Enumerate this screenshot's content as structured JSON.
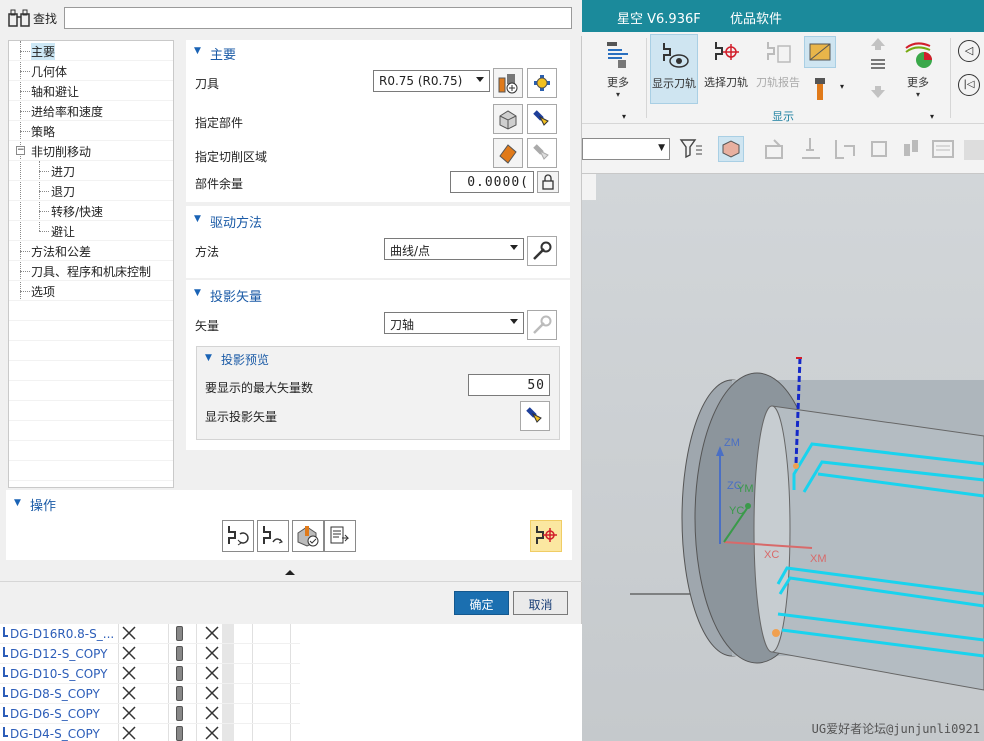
{
  "app": {
    "title": "星空 V6.936F",
    "subtitle": "优品软件"
  },
  "ribbon": {
    "more_label_1": "更多",
    "show_path_label": "显示刀轨",
    "select_path_label": "选择刀轨",
    "path_report_label": "刀轨报告",
    "more_label_2": "更多",
    "group_label": "显示"
  },
  "find": {
    "label": "查找",
    "value": ""
  },
  "tree": {
    "items": [
      {
        "label": "主要"
      },
      {
        "label": "几何体"
      },
      {
        "label": "轴和避让"
      },
      {
        "label": "进给率和速度"
      },
      {
        "label": "策略"
      },
      {
        "label": "非切削移动"
      },
      {
        "label": "进刀"
      },
      {
        "label": "退刀"
      },
      {
        "label": "转移/快速"
      },
      {
        "label": "避让"
      },
      {
        "label": "方法和公差"
      },
      {
        "label": "刀具、程序和机床控制"
      },
      {
        "label": "选项"
      }
    ]
  },
  "main_section": {
    "title": "主要",
    "tool_label": "刀具",
    "tool_value": "R0.75 (R0.75)",
    "part_label": "指定部件",
    "cut_region_label": "指定切削区域",
    "stock_label": "部件余量",
    "stock_value": "0.0000("
  },
  "drive_section": {
    "title": "驱动方法",
    "method_label": "方法",
    "method_value": "曲线/点"
  },
  "projection_section": {
    "title": "投影矢量",
    "vector_label": "矢量",
    "vector_value": "刀轴",
    "preview": {
      "title": "投影预览",
      "max_vectors_label": "要显示的最大矢量数",
      "max_vectors_value": "50",
      "show_vectors_label": "显示投影矢量"
    }
  },
  "operations": {
    "title": "操作"
  },
  "footer": {
    "ok_label": "确定",
    "cancel_label": "取消"
  },
  "viewport": {
    "axis_zm": "ZM",
    "axis_zc": "ZC",
    "axis_ym": "YM",
    "axis_yc": "YC",
    "axis_xc": "XC",
    "axis_xm": "XM",
    "watermark": "UG爱好者论坛@junjunli0921"
  },
  "operation_list": {
    "rows": [
      {
        "name": "DG-D16R0.8-S_..."
      },
      {
        "name": "DG-D12-S_COPY"
      },
      {
        "name": "DG-D10-S_COPY"
      },
      {
        "name": "DG-D8-S_COPY"
      },
      {
        "name": "DG-D6-S_COPY"
      },
      {
        "name": "DG-D4-S_COPY"
      }
    ]
  },
  "colors": {
    "accent": "#1b8a9b",
    "section_title": "#1a5aa6",
    "ok_button": "#1b6fb0",
    "toolpath": "#19d3ee"
  }
}
